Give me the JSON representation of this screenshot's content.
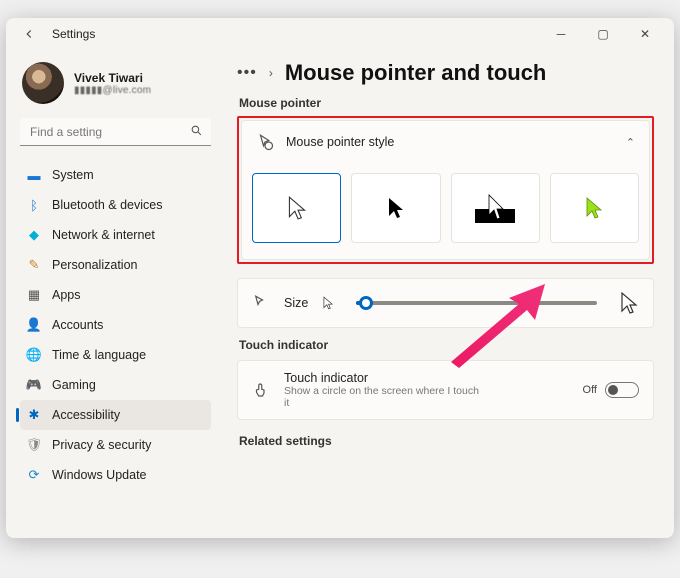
{
  "window": {
    "app_title": "Settings"
  },
  "profile": {
    "name": "Vivek Tiwari",
    "email": "▮▮▮▮▮@live.com"
  },
  "search": {
    "placeholder": "Find a setting"
  },
  "nav": {
    "items": [
      {
        "label": "System"
      },
      {
        "label": "Bluetooth & devices"
      },
      {
        "label": "Network & internet"
      },
      {
        "label": "Personalization"
      },
      {
        "label": "Apps"
      },
      {
        "label": "Accounts"
      },
      {
        "label": "Time & language"
      },
      {
        "label": "Gaming"
      },
      {
        "label": "Accessibility"
      },
      {
        "label": "Privacy & security"
      },
      {
        "label": "Windows Update"
      }
    ]
  },
  "breadcrumb": {
    "page_title": "Mouse pointer and touch"
  },
  "sections": {
    "mouse_pointer": "Mouse pointer",
    "touch_indicator": "Touch indicator",
    "related": "Related settings"
  },
  "cards": {
    "style": {
      "title": "Mouse pointer style"
    },
    "size": {
      "label": "Size"
    },
    "touch": {
      "title": "Touch indicator",
      "subtitle": "Show a circle on the screen where I touch it",
      "state_label": "Off",
      "state": false
    }
  },
  "colors": {
    "accent": "#0067c0",
    "highlight": "#e31b23",
    "arrow": "#ec1a64"
  }
}
